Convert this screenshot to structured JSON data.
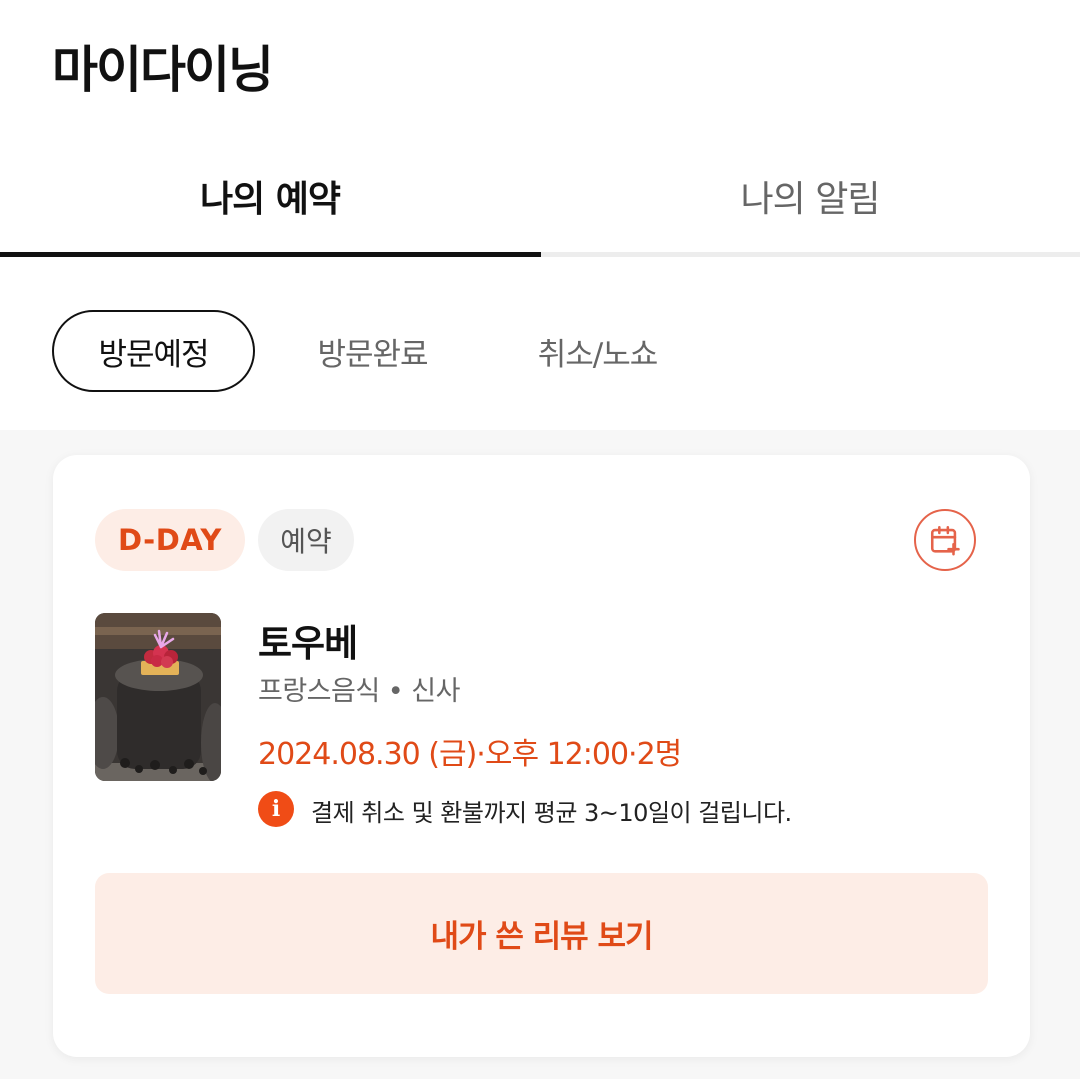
{
  "header": {
    "title": "마이다이닝"
  },
  "tabs": [
    {
      "label": "나의 예약",
      "active": true
    },
    {
      "label": "나의 알림",
      "active": false
    }
  ],
  "filters": [
    {
      "label": "방문예정",
      "selected": true
    },
    {
      "label": "방문완료",
      "selected": false
    },
    {
      "label": "취소/노쇼",
      "selected": false
    }
  ],
  "reservation": {
    "dday_badge": "D-DAY",
    "status_badge": "예약",
    "calendar_icon": "calendar-add-icon",
    "thumbnail_icon": "restaurant-photo",
    "restaurant_name": "토우베",
    "restaurant_meta": "프랑스음식 • 신사",
    "datetime": "2024.08.30 (금)·오후 12:00·2명",
    "notice_icon": "info-icon",
    "notice": "결제 취소 및 환불까지 평균 3~10일이 걸립니다.",
    "review_button": "내가 쓴 리뷰 보기"
  },
  "colors": {
    "accent": "#e04a17",
    "accent_bg": "#fdede6",
    "text_primary": "#111111",
    "text_secondary": "#666666"
  }
}
